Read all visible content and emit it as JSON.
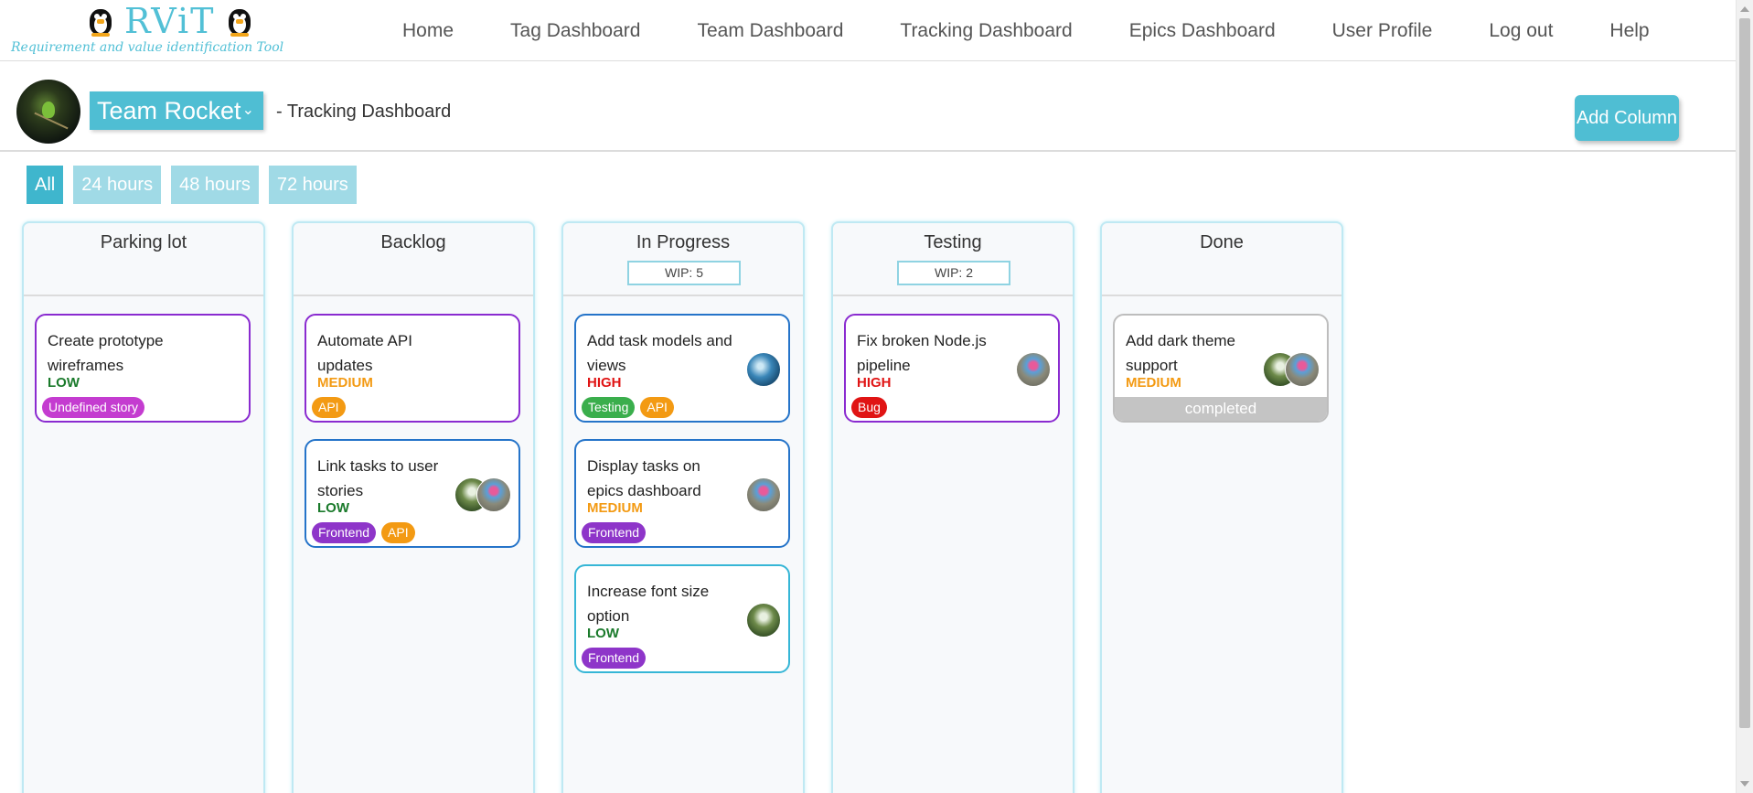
{
  "brand": {
    "name": "RViT",
    "subtitle": "Requirement and value identification Tool"
  },
  "nav": [
    "Home",
    "Tag Dashboard",
    "Team Dashboard",
    "Tracking Dashboard",
    "Epics Dashboard",
    "User Profile",
    "Log out",
    "Help"
  ],
  "header": {
    "team_name": "Team Rocket",
    "dashboard_label": "- Tracking Dashboard",
    "add_column_label": "Add Column"
  },
  "filters": [
    "All",
    "24 hours",
    "48 hours",
    "72 hours"
  ],
  "columns": [
    {
      "title": "Parking lot",
      "wip": null,
      "cards": [
        {
          "title": "Create prototype wireframes",
          "priority": "LOW",
          "tags": [
            "Undefined story"
          ],
          "assignees": []
        }
      ]
    },
    {
      "title": "Backlog",
      "wip": null,
      "cards": [
        {
          "title": "Automate API updates",
          "priority": "MEDIUM",
          "tags": [
            "API"
          ],
          "assignees": []
        },
        {
          "title": "Link tasks to user stories",
          "priority": "LOW",
          "tags": [
            "Frontend",
            "API"
          ],
          "assignees": [
            "forest-avatar",
            "balloon-avatar"
          ]
        }
      ]
    },
    {
      "title": "In Progress",
      "wip": "WIP: 5",
      "cards": [
        {
          "title": "Add task models and views",
          "priority": "HIGH",
          "tags": [
            "Testing",
            "API"
          ],
          "assignees": [
            "water-avatar"
          ]
        },
        {
          "title": "Display tasks on epics dashboard",
          "priority": "MEDIUM",
          "tags": [
            "Frontend"
          ],
          "assignees": [
            "balloon-avatar"
          ]
        },
        {
          "title": "Increase font size option",
          "priority": "LOW",
          "tags": [
            "Frontend"
          ],
          "assignees": [
            "forest-avatar"
          ]
        }
      ]
    },
    {
      "title": "Testing",
      "wip": "WIP: 2",
      "cards": [
        {
          "title": "Fix broken Node.js pipeline",
          "priority": "HIGH",
          "tags": [
            "Bug"
          ],
          "assignees": [
            "balloon-avatar"
          ]
        }
      ]
    },
    {
      "title": "Done",
      "wip": null,
      "cards": [
        {
          "title": "Add dark theme support",
          "priority": "MEDIUM",
          "tags": [],
          "assignees": [
            "forest-avatar",
            "balloon-avatar"
          ],
          "status": "completed"
        }
      ]
    }
  ],
  "colors": {
    "accent": "#4fbed3",
    "priority_low": "#1a7a2b",
    "priority_medium": "#f39a13",
    "priority_high": "#e01414"
  }
}
